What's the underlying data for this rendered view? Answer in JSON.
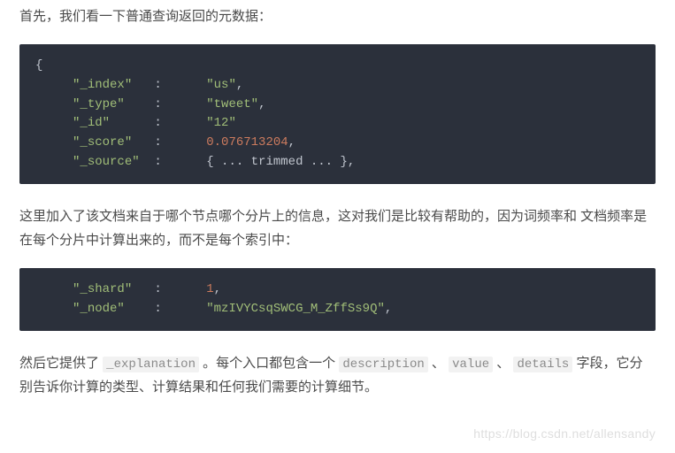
{
  "para1": "首先，我们看一下普通查询返回的元数据：",
  "code1": {
    "rows": [
      {
        "key": "\"_index\"",
        "val": "\"us\"",
        "class": "str",
        "trail": ","
      },
      {
        "key": "\"_type\"",
        "val": "\"tweet\"",
        "class": "str",
        "trail": ","
      },
      {
        "key": "\"_id\"",
        "val": "\"12\"",
        "class": "str",
        "trail": ""
      },
      {
        "key": "\"_score\"",
        "val": "0.076713204",
        "class": "num",
        "trail": ","
      },
      {
        "key": "\"_source\"",
        "val": "{ ... trimmed ... }",
        "class": "punct",
        "trail": ","
      }
    ]
  },
  "para2": "这里加入了该文档来自于哪个节点哪个分片上的信息，这对我们是比较有帮助的，因为词频率和 文档频率是在每个分片中计算出来的，而不是每个索引中：",
  "code2": {
    "rows": [
      {
        "key": "\"_shard\"",
        "val": "1",
        "class": "num",
        "trail": ","
      },
      {
        "key": "\"_node\"",
        "val": "\"mzIVYCsqSWCG_M_ZffSs9Q\"",
        "class": "str",
        "trail": ","
      }
    ]
  },
  "para3": {
    "t0": "然后它提供了 ",
    "c0": "_explanation",
    "t1": " 。每个入口都包含一个 ",
    "c1": "description",
    "t2": " 、 ",
    "c2": "value",
    "t3": " 、 ",
    "c3": "details",
    "t4": " 字段，它分别告诉你计算的类型、计算结果和任何我们需要的计算细节。"
  },
  "watermark": "https://blog.csdn.net/allensandy"
}
